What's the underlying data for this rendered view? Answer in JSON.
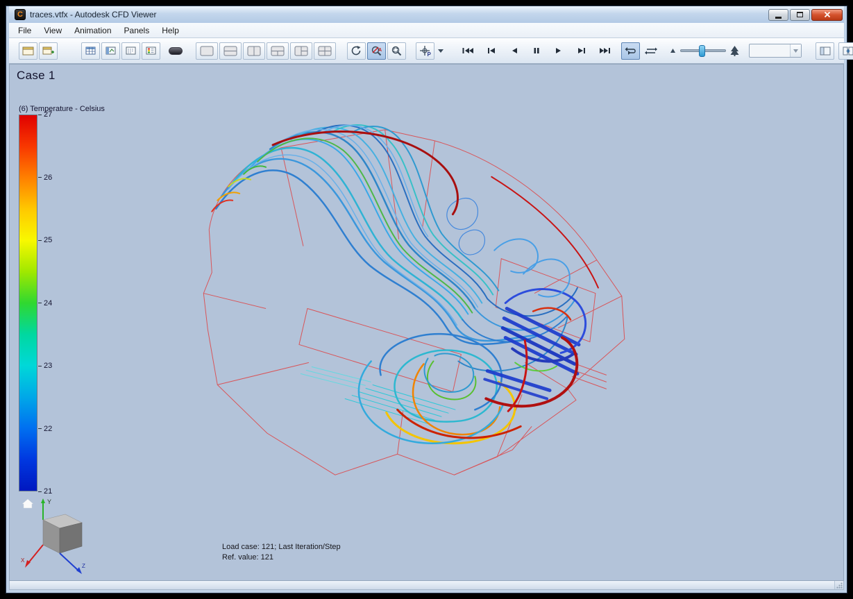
{
  "window": {
    "title": "traces.vtfx - Autodesk CFD Viewer",
    "icon_letter": "C"
  },
  "menu": {
    "items": [
      "File",
      "View",
      "Animation",
      "Panels",
      "Help"
    ]
  },
  "toolbar": {
    "frame_select_value": "",
    "buttons": [
      "report",
      "new-view",
      "table",
      "plot-panel",
      "outline-panel",
      "legend-panel",
      "display-dark",
      "layout-single",
      "layout-split-horizontal",
      "layout-split-vertical",
      "layout-three-bottom",
      "layout-three-right",
      "layout-quad",
      "rotate-view",
      "zoom-area",
      "zoom-window",
      "probe-point",
      "probe-menu",
      "first-frame",
      "previous-frame",
      "play-backward",
      "pause",
      "play-forward",
      "next-frame",
      "last-frame",
      "loop",
      "bounce",
      "speed-down",
      "speed-slider",
      "speed-up",
      "frame-select",
      "add-pane",
      "split-pane",
      "link-views"
    ],
    "icons": {
      "rotate-view": "circular-arrow",
      "zoom-area": "magnifier-red-a",
      "zoom-window": "magnifier-box",
      "probe-point": "crosshair-p",
      "playback": "transport-triangles",
      "loop": "cycle-arrows",
      "bounce": "back-forth-arrows"
    }
  },
  "viewport": {
    "case_label": "Case 1",
    "legend": {
      "title": "(6) Temperature - Celsius",
      "ticks": [
        "27",
        "26",
        "25",
        "24",
        "23",
        "22",
        "21"
      ],
      "colors": [
        "#e00000",
        "#f83800",
        "#ff8000",
        "#ffc800",
        "#f8f800",
        "#a0e800",
        "#30d830",
        "#00d8a0",
        "#00d8d8",
        "#00a8e8",
        "#0070f0",
        "#0038e0",
        "#0018c0"
      ]
    },
    "status": {
      "line1": "Load case: 121; Last Iteration/Step",
      "line2": "Ref. value: 121"
    },
    "nav_cube": {
      "y": "Y",
      "x": "X",
      "z": "Z"
    }
  }
}
